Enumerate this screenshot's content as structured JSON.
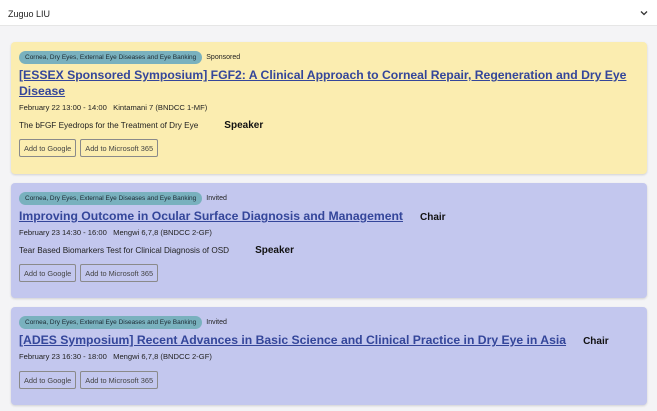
{
  "selector": {
    "value": "Zuguo LIU"
  },
  "buttons": {
    "google": "Add to Google",
    "microsoft": "Add to Microsoft 365"
  },
  "sessions": [
    {
      "category": "Cornea, Dry Eyes, External Eye Diseases and Eye Banking",
      "type": "Sponsored",
      "title": "[ESSEX Sponsored Symposium] FGF2: A Clinical Approach to Corneal Repair, Regeneration and Dry Eye Disease",
      "role": "",
      "meta": "February 22 13:00 - 14:00   Kintamani 7 (BNDCC 1-MF)",
      "talk": "The bFGF Eyedrops for the Treatment of Dry Eye",
      "talk_role": "Speaker"
    },
    {
      "category": "Cornea, Dry Eyes, External Eye Diseases and Eye Banking",
      "type": "Invited",
      "title": "Improving Outcome in Ocular Surface Diagnosis and Management",
      "role": "Chair",
      "meta": "February 23 14:30 - 16:00   Mengwi 6,7,8 (BNDCC 2-GF)",
      "talk": "Tear Based Biomarkers Test for Clinical Diagnosis of OSD",
      "talk_role": "Speaker"
    },
    {
      "category": "Cornea, Dry Eyes, External Eye Diseases and Eye Banking",
      "type": "Invited",
      "title": "[ADES Symposium] Recent Advances in Basic Science and Clinical Practice in Dry Eye in Asia",
      "role": "Chair",
      "meta": "February 23 16:30 - 18:00   Mengwi 6,7,8 (BNDCC 2-GF)",
      "talk": "",
      "talk_role": ""
    }
  ]
}
